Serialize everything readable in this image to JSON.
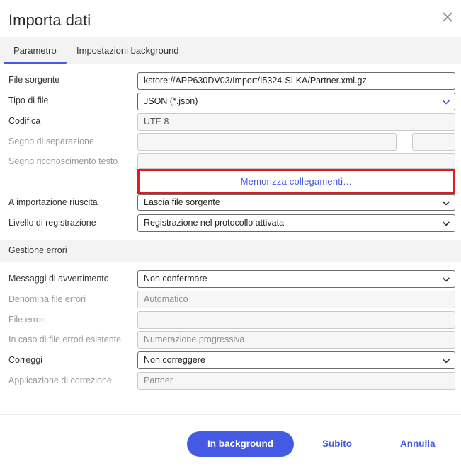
{
  "dialog": {
    "title": "Importa dati",
    "close_icon": "close-icon"
  },
  "tabs": [
    {
      "label": "Parametro",
      "active": true
    },
    {
      "label": "Impostazioni background",
      "active": false
    }
  ],
  "params": {
    "source_file": {
      "label": "File sorgente",
      "value": "kstore://APP630DV03/Import/I5324-SLKA/Partner.xml.gz"
    },
    "file_type": {
      "label": "Tipo di file",
      "value": "JSON (*.json)"
    },
    "encoding": {
      "label": "Codifica",
      "value": "UTF-8"
    },
    "separator": {
      "label": "Segno di separazione",
      "value": ""
    },
    "text_qualifier": {
      "label": "Segno riconoscimento testo",
      "value": ""
    },
    "memorize_links": "Memorizza collegamenti…",
    "on_success": {
      "label": "A importazione riuscita",
      "value": "Lascia file sorgente"
    },
    "log_level": {
      "label": "Livello di registrazione",
      "value": "Registrazione nel protocollo attivata"
    }
  },
  "errors": {
    "section_title": "Gestione errori",
    "warnings": {
      "label": "Messaggi di avvertimento",
      "value": "Non confermare"
    },
    "error_file_name": {
      "label": "Denomina file errori",
      "value": "Automatico"
    },
    "error_file": {
      "label": "File errori",
      "value": ""
    },
    "existing_error_file": {
      "label": "In caso di file errori esistente",
      "value": "Numerazione progressiva"
    },
    "correct": {
      "label": "Correggi",
      "value": "Non correggere"
    },
    "correction_app": {
      "label": "Applicazione di correzione",
      "value": "Partner"
    }
  },
  "footer": {
    "background_label": "In background",
    "now_label": "Subito",
    "cancel_label": "Annulla"
  },
  "colors": {
    "accent": "#4459e4",
    "highlight_border": "#e11b22"
  }
}
